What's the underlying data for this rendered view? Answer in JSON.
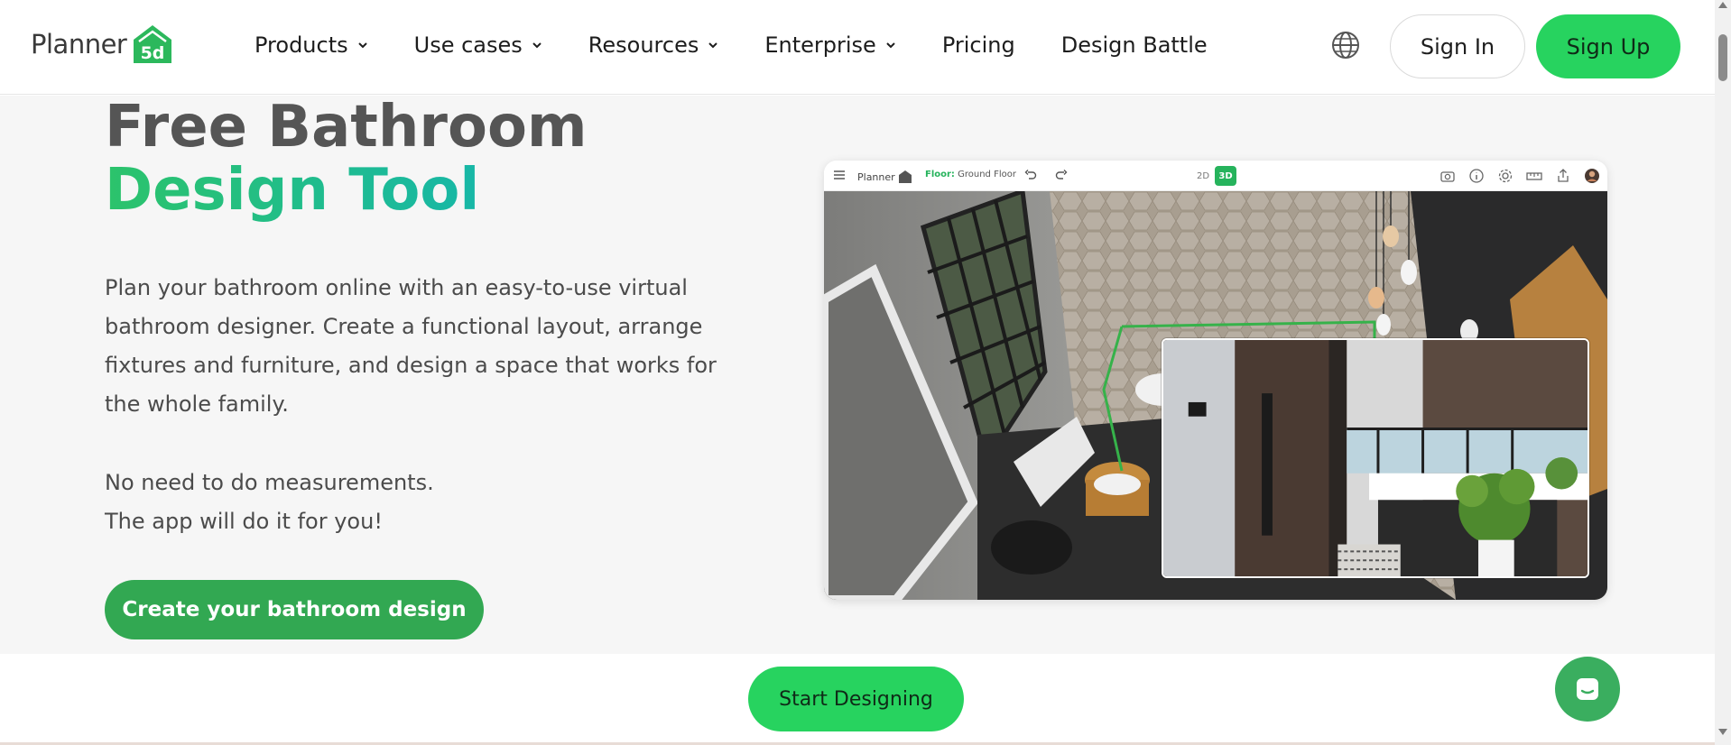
{
  "header": {
    "logo_text": "Planner",
    "nav": [
      {
        "label": "Products",
        "has_dropdown": true
      },
      {
        "label": "Use cases",
        "has_dropdown": true
      },
      {
        "label": "Resources",
        "has_dropdown": true
      },
      {
        "label": "Enterprise",
        "has_dropdown": true
      },
      {
        "label": "Pricing",
        "has_dropdown": false
      },
      {
        "label": "Design Battle",
        "has_dropdown": false
      }
    ],
    "language_icon": "globe-icon",
    "sign_in_label": "Sign In",
    "sign_up_label": "Sign Up"
  },
  "hero": {
    "title_line1": "Free Bathroom",
    "title_line2": "Design Tool",
    "description": "Plan your bathroom online with an easy-to-use virtual bathroom designer. Create a functional layout, arrange fixtures and furniture, and design a space that works for the whole family.",
    "note_line1": "No need to do measurements.",
    "note_line2": "The app will do it for you!",
    "cta_label": "Create your bathroom design"
  },
  "preview": {
    "logo_text": "Planner",
    "floor_label": "Floor:",
    "floor_value": "Ground Floor",
    "mode_2d": "2D",
    "mode_3d": "3D",
    "active_mode": "3D",
    "toolbar_icons": [
      "camera-icon",
      "info-icon",
      "settings-icon",
      "ruler-icon",
      "share-icon",
      "avatar"
    ]
  },
  "bottom": {
    "start_label": "Start Designing",
    "chat_icon": "chat-icon"
  },
  "colors": {
    "brand_green": "#27d35f",
    "cta_green": "#32a852",
    "title_gray": "#555555",
    "gradient_start": "#2cc36b",
    "gradient_end": "#17b7a7"
  }
}
